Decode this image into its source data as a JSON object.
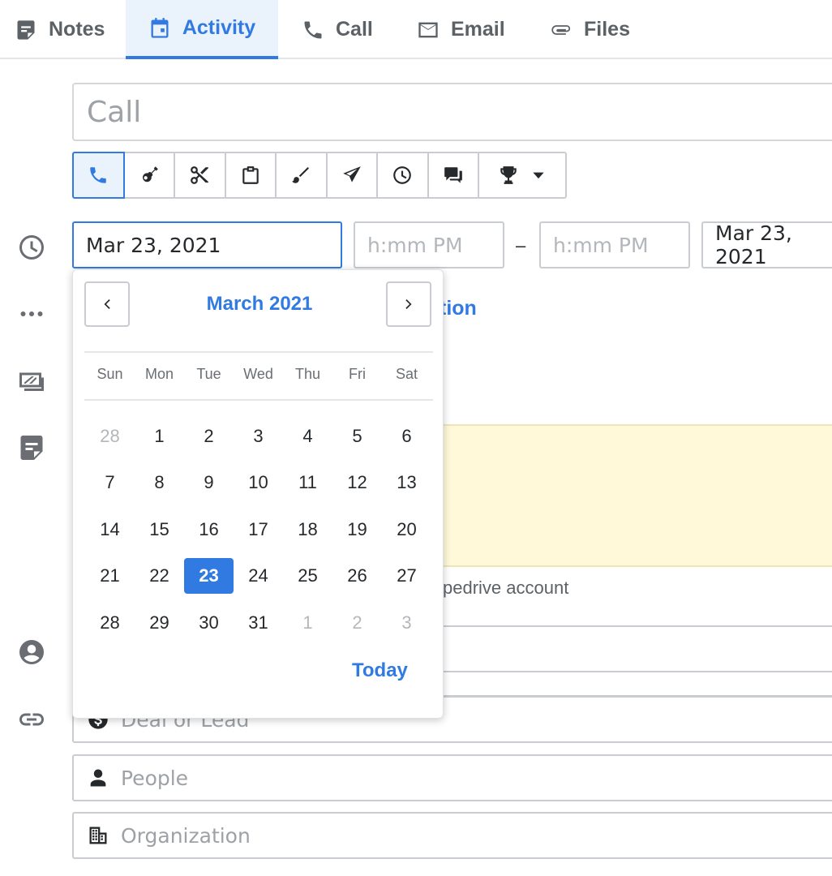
{
  "tabs": [
    {
      "label": "Notes",
      "icon": "note-icon"
    },
    {
      "label": "Activity",
      "icon": "calendar-icon"
    },
    {
      "label": "Call",
      "icon": "phone-icon"
    },
    {
      "label": "Email",
      "icon": "envelope-icon"
    },
    {
      "label": "Files",
      "icon": "paperclip-icon"
    }
  ],
  "subject": {
    "placeholder": "Call"
  },
  "activity_types": [
    "phone-icon",
    "guitar-icon",
    "scissors-icon",
    "clipboard-icon",
    "brush-icon",
    "send-icon",
    "clock-icon",
    "chat-icon",
    "trophy-icon"
  ],
  "schedule": {
    "start_date": "Mar 23, 2021",
    "start_time_placeholder": "h:mm PM",
    "separator": "–",
    "end_time_placeholder": "h:mm PM",
    "end_date": "Mar 23, 2021"
  },
  "background": {
    "link_fragment": "tion",
    "note_footer_fragment": "pedrive account",
    "deal_placeholder": "Deal or Lead",
    "people_placeholder": "People",
    "organization_placeholder": "Organization"
  },
  "picker": {
    "month_title": "March 2021",
    "weekdays": [
      "Sun",
      "Mon",
      "Tue",
      "Wed",
      "Thu",
      "Fri",
      "Sat"
    ],
    "days": [
      [
        "28",
        "1",
        "2",
        "3",
        "4",
        "5",
        "6"
      ],
      [
        "7",
        "8",
        "9",
        "10",
        "11",
        "12",
        "13"
      ],
      [
        "14",
        "15",
        "16",
        "17",
        "18",
        "19",
        "20"
      ],
      [
        "21",
        "22",
        "23",
        "24",
        "25",
        "26",
        "27"
      ],
      [
        "28",
        "29",
        "30",
        "31",
        "1",
        "2",
        "3"
      ]
    ],
    "selected_day": "23",
    "today_label": "Today"
  },
  "colors": {
    "accent": "#317ae2",
    "note_bg": "#fff9d9",
    "text": "#26292c",
    "muted": "#b3b7bb"
  }
}
